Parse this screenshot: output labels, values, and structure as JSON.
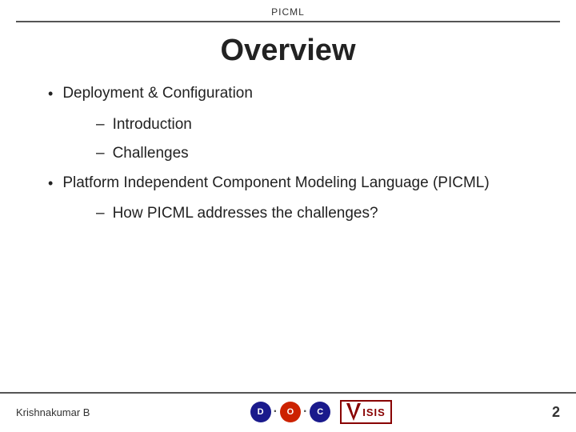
{
  "header": {
    "title": "PICML"
  },
  "slide": {
    "title": "Overview"
  },
  "content": {
    "bullets": [
      {
        "id": "bullet1",
        "text": "Deployment & Configuration",
        "subItems": [
          {
            "id": "sub1",
            "text": "Introduction"
          },
          {
            "id": "sub2",
            "text": "Challenges"
          }
        ]
      },
      {
        "id": "bullet2",
        "text": "Platform Independent Component Modeling Language (PICML)",
        "subItems": [
          {
            "id": "sub3",
            "text": "How PICML addresses the challenges?"
          }
        ]
      }
    ]
  },
  "footer": {
    "author": "Krishnakumar B",
    "page_number": "2",
    "logos": {
      "doc_letters": [
        "D",
        "O",
        "C"
      ],
      "isis_label": "ISIS"
    }
  }
}
